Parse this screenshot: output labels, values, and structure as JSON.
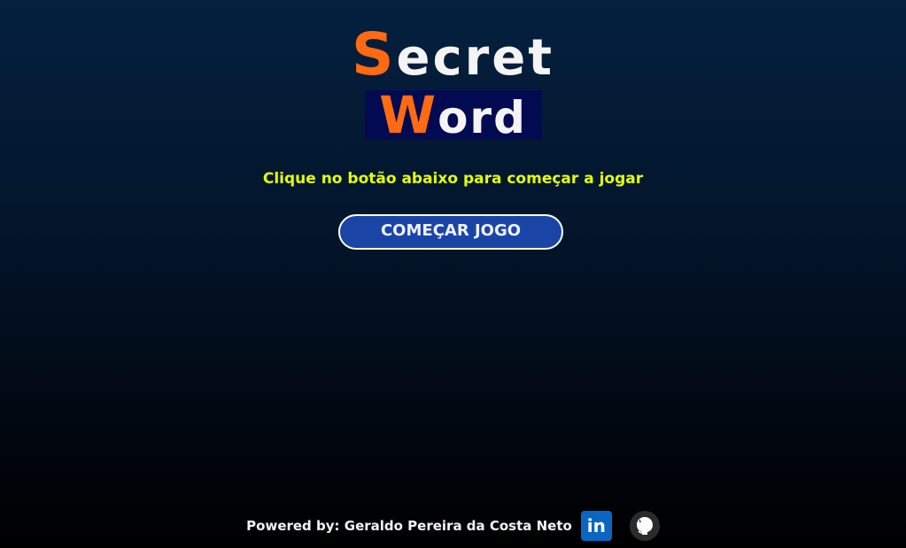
{
  "title": {
    "line1_first": "S",
    "line1_rest": "ecret",
    "line2_first": "W",
    "line2_rest": "ord"
  },
  "subtitle": "Clique no botão abaixo para começar a jogar",
  "start_button_label": "COMEÇAR JOGO",
  "footer": {
    "text": "Powered by: Geraldo Pereira da Costa Neto",
    "linkedin_label": "in",
    "linkedin_icon": "linkedin-icon",
    "github_icon": "github-icon"
  },
  "colors": {
    "accent_orange": "#ff6a13",
    "subtitle_yellow": "#e5ff00",
    "button_blue": "#1a45a6",
    "title_box_navy": "#020a52"
  }
}
